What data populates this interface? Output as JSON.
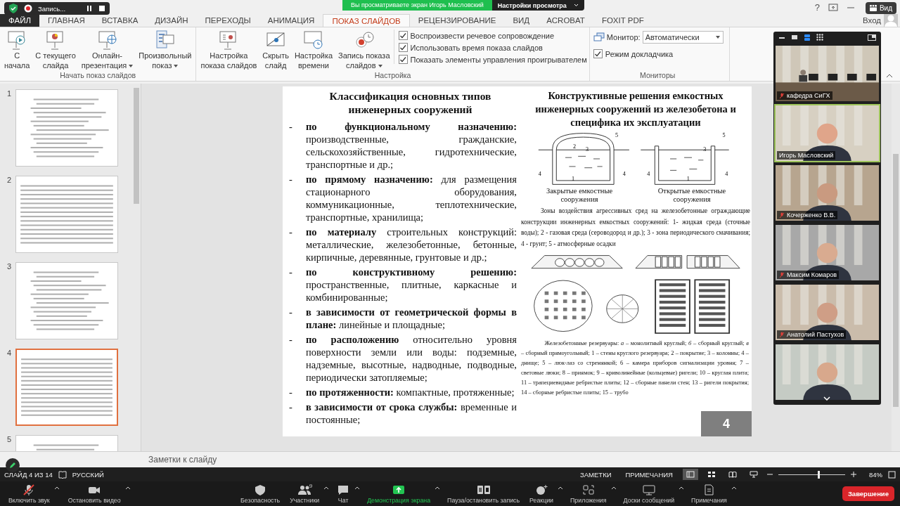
{
  "recording": {
    "label": "Запись..."
  },
  "share_banner": {
    "text": "Вы просматриваете экран Игорь Масловский",
    "options": "Настройки просмотра"
  },
  "title_bar": {
    "help": "?",
    "view_button": "Вид"
  },
  "tabs": [
    {
      "label": "ФАЙЛ",
      "kind": "file",
      "selected": false
    },
    {
      "label": "ГЛАВНАЯ",
      "kind": "tab",
      "selected": false
    },
    {
      "label": "ВСТАВКА",
      "kind": "tab",
      "selected": false
    },
    {
      "label": "ДИЗАЙН",
      "kind": "tab",
      "selected": false
    },
    {
      "label": "ПЕРЕХОДЫ",
      "kind": "tab",
      "selected": false
    },
    {
      "label": "АНИМАЦИЯ",
      "kind": "tab",
      "selected": false
    },
    {
      "label": "ПОКАЗ СЛАЙДОВ",
      "kind": "tab",
      "selected": true
    },
    {
      "label": "РЕЦЕНЗИРОВАНИЕ",
      "kind": "tab",
      "selected": false
    },
    {
      "label": "ВИД",
      "kind": "tab",
      "selected": false
    },
    {
      "label": "ACROBAT",
      "kind": "tab",
      "selected": false
    },
    {
      "label": "FOXIT PDF",
      "kind": "tab",
      "selected": false
    }
  ],
  "sign_in": "Вход",
  "ribbon_groups": [
    {
      "title": "Начать показ слайдов",
      "buttons": [
        {
          "label": "С\nначала",
          "kind": "play",
          "dropdown": false
        },
        {
          "label": "С текущего\nслайда",
          "kind": "current",
          "dropdown": false
        },
        {
          "label": "Онлайн-\nпрезентация",
          "kind": "online",
          "dropdown": true
        },
        {
          "label": "Произвольный\nпоказ",
          "kind": "custom",
          "dropdown": true
        }
      ]
    },
    {
      "title": "Настройка",
      "buttons": [
        {
          "label": "Настройка\nпоказа слайдов",
          "kind": "setup",
          "dropdown": false
        },
        {
          "label": "Скрыть\nслайд",
          "kind": "hide",
          "dropdown": false
        },
        {
          "label": "Настройка\nвремени",
          "kind": "timing",
          "dropdown": false
        },
        {
          "label": "Запись показа\nслайдов",
          "kind": "record",
          "dropdown": true
        }
      ],
      "checkboxes": [
        {
          "label": "Воспроизвести речевое сопровождение",
          "checked": true
        },
        {
          "label": "Использовать время показа слайдов",
          "checked": true
        },
        {
          "label": "Показать элементы управления проигрывателем",
          "checked": true
        }
      ]
    },
    {
      "title": "Мониторы",
      "monitor": {
        "label": "Монитор:",
        "value": "Автоматически"
      },
      "checkboxes": [
        {
          "label": "Режим докладчика",
          "checked": true
        }
      ]
    }
  ],
  "slides": [
    {
      "number": "1",
      "selected": false
    },
    {
      "number": "2",
      "selected": false
    },
    {
      "number": "3",
      "selected": false
    },
    {
      "number": "4",
      "selected": true
    },
    {
      "number": "5",
      "selected": false
    }
  ],
  "slide": {
    "left": {
      "title": "Классификация основных типов инженерных сооружений",
      "items": [
        {
          "bullet": "-",
          "text": "**по функциональному назначению:** производственные, гражданские, сельскохозяйственные, гидротехнические, транспортные и др.;"
        },
        {
          "bullet": "-",
          "text": "**по прямому назначению:** для размещения стационарного оборудования, коммуникационные, теплотехнические, транспортные, хранилища;"
        },
        {
          "bullet": "-",
          "text": "**по материалу** строительных конструкций: металлические, железобетонные, бетонные, кирпичные, деревянные, грунтовые и др.;"
        },
        {
          "bullet": "-",
          "text": "**по конструктивному решению:** пространственные, плитные, каркасные и комбинированные;"
        },
        {
          "bullet": "-",
          "text": "**в зависимости от геометрической формы в плане:** линейные и площадные;"
        },
        {
          "bullet": "-",
          "text": "**по расположению** относительно уровня поверхности земли или воды: подземные, надземные, высотные, надводные, подводные, периодически затопляемые;"
        },
        {
          "bullet": "-",
          "text": "**по протяженности:** компактные, протяженные;"
        },
        {
          "bullet": "-",
          "text": "**в зависимости от срока службы:** временные и постоянные;"
        }
      ]
    },
    "right": {
      "title": "Конструктивные решения емкостных инженерных сооружений из железобетона и специфика их эксплуатации",
      "tanks": [
        {
          "kind": "closed",
          "caption": "Закрытые емкостные сооружения",
          "labels": [
            "5",
            "2",
            "3",
            "4",
            "4",
            "1"
          ]
        },
        {
          "kind": "open",
          "caption": "Открытые емкостные сооружения",
          "labels": [
            "5",
            "3",
            "4",
            "4",
            "1"
          ]
        }
      ],
      "zones_text": "Зоны воздействия агрессивных сред на железобетонные ограждающие конструкции инженерных емкостных сооружений: 1- жидкая среда (сточные воды); 2 - газовая среда (сероводород и др.); 3 - зона периодического смачивания; 4 - грунт; 5 - атмосферные осадки",
      "figure_caption": "Железобетонные резервуары: *а* – монолитный круглый; *б* – сборный круглый; *в* – сборный прямоугольный; 1 – стены круглого резервуара; 2 – покрытие; 3 – колонны; 4 – днище; 5 – люк-лаз со стремянкой; 6 – камера приборов сигнализации уровня; 7 – световые люки; 8 – приямок; 9 – криволинейные (кольцевые) ригели; 10 – круглая плита; 11 – трапециевидные ребристые плиты; 12 – сборные панели стен; 13 – ригели покрытия; 14 – сборные ребристые плиты; 15 – трубо"
    },
    "page_number": "4"
  },
  "notes": {
    "placeholder": "Заметки к слайду"
  },
  "status_bar": {
    "slide_counter": "СЛАЙД 4 ИЗ 14",
    "language": "РУССКИЙ",
    "notes": "ЗАМЕТКИ",
    "comments": "ПРИМЕЧАНИЯ",
    "views": [
      {
        "kind": "normal",
        "selected": true
      },
      {
        "kind": "sorter",
        "selected": false
      },
      {
        "kind": "reading",
        "selected": false
      },
      {
        "kind": "slideshow",
        "selected": false
      }
    ],
    "zoom": {
      "level": 0.6,
      "reading": "84%"
    }
  },
  "video_tiles": [
    {
      "kind": "room",
      "name": "кафедра СиГХ",
      "muted": true,
      "active": false
    },
    {
      "kind": "person",
      "name": "Игорь Масловский",
      "muted": false,
      "active": true
    },
    {
      "kind": "person",
      "name": "Кочерженко В.В.",
      "muted": true,
      "active": false
    },
    {
      "kind": "person",
      "name": "Максим Комаров",
      "muted": true,
      "active": false
    },
    {
      "kind": "person",
      "name": "Анатолий Пастухов",
      "muted": true,
      "active": false
    },
    {
      "kind": "person",
      "active": false
    }
  ],
  "meeting_toolbar": {
    "buttons": [
      {
        "label": "Включить звук",
        "kind": "mic-off",
        "caret": true,
        "active": false
      },
      {
        "label": "Остановить видео",
        "kind": "video",
        "caret": true,
        "active": false
      },
      {
        "label": "Безопасность",
        "kind": "shield",
        "caret": false,
        "active": false
      },
      {
        "label": "Участники",
        "kind": "people",
        "caret": true,
        "active": false,
        "badge": "9"
      },
      {
        "label": "Чат",
        "kind": "chat",
        "caret": true,
        "active": false
      },
      {
        "label": "Демонстрация экрана",
        "kind": "share",
        "caret": true,
        "active": true
      },
      {
        "label": "Пауза/остановить запись",
        "kind": "pause-stop",
        "caret": false,
        "active": false
      },
      {
        "label": "Реакции",
        "kind": "reaction",
        "caret": true,
        "active": false
      },
      {
        "label": "Приложения",
        "kind": "apps",
        "caret": true,
        "active": false
      },
      {
        "label": "Доски сообщений",
        "kind": "whiteboard",
        "caret": true,
        "active": false
      },
      {
        "label": "Примечания",
        "kind": "notes",
        "caret": true,
        "active": false
      }
    ],
    "end_button": "Завершение"
  }
}
